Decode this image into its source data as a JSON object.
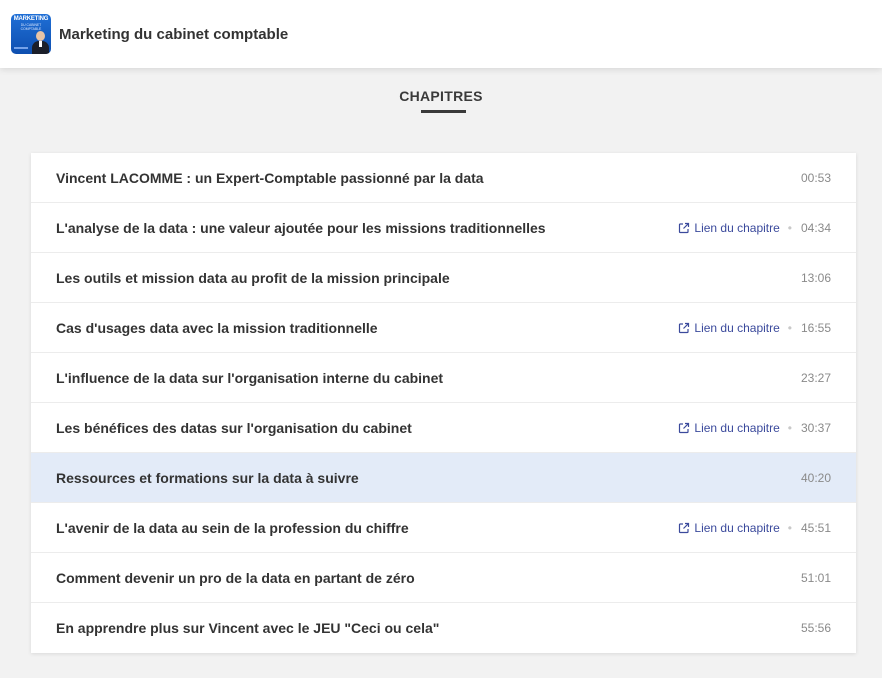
{
  "header": {
    "title": "Marketing du cabinet comptable",
    "logo_text_line1": "MARKETING",
    "logo_text_line2": "DU CABINET COMPTABLE",
    "logo_color": "#1f6fd6"
  },
  "chapters_title": "CHAPITRES",
  "link_label": "Lien du chapitre",
  "link_icon": "external-link-icon",
  "active_row_color": "#e3ebf8",
  "link_color": "#3b4a9c",
  "chapters": [
    {
      "title": "Vincent LACOMME : un Expert-Comptable passionné par la data",
      "time": "00:53",
      "has_link": false,
      "active": false
    },
    {
      "title": "L'analyse de la data : une valeur ajoutée pour les missions traditionnelles",
      "time": "04:34",
      "has_link": true,
      "active": false
    },
    {
      "title": "Les outils et mission data au profit de la mission principale",
      "time": "13:06",
      "has_link": false,
      "active": false
    },
    {
      "title": "Cas d'usages data avec la mission traditionnelle",
      "time": "16:55",
      "has_link": true,
      "active": false
    },
    {
      "title": "L'influence de la data sur l'organisation interne du cabinet",
      "time": "23:27",
      "has_link": false,
      "active": false
    },
    {
      "title": "Les bénéfices des datas sur l'organisation du cabinet",
      "time": "30:37",
      "has_link": true,
      "active": false
    },
    {
      "title": "Ressources et formations sur la data à suivre",
      "time": "40:20",
      "has_link": false,
      "active": true
    },
    {
      "title": "L'avenir de la data au sein de la profession du chiffre",
      "time": "45:51",
      "has_link": true,
      "active": false
    },
    {
      "title": "Comment devenir un pro de la data en partant de zéro",
      "time": "51:01",
      "has_link": false,
      "active": false
    },
    {
      "title": "En apprendre plus sur Vincent avec le JEU \"Ceci ou cela\"",
      "time": "55:56",
      "has_link": false,
      "active": false
    }
  ]
}
